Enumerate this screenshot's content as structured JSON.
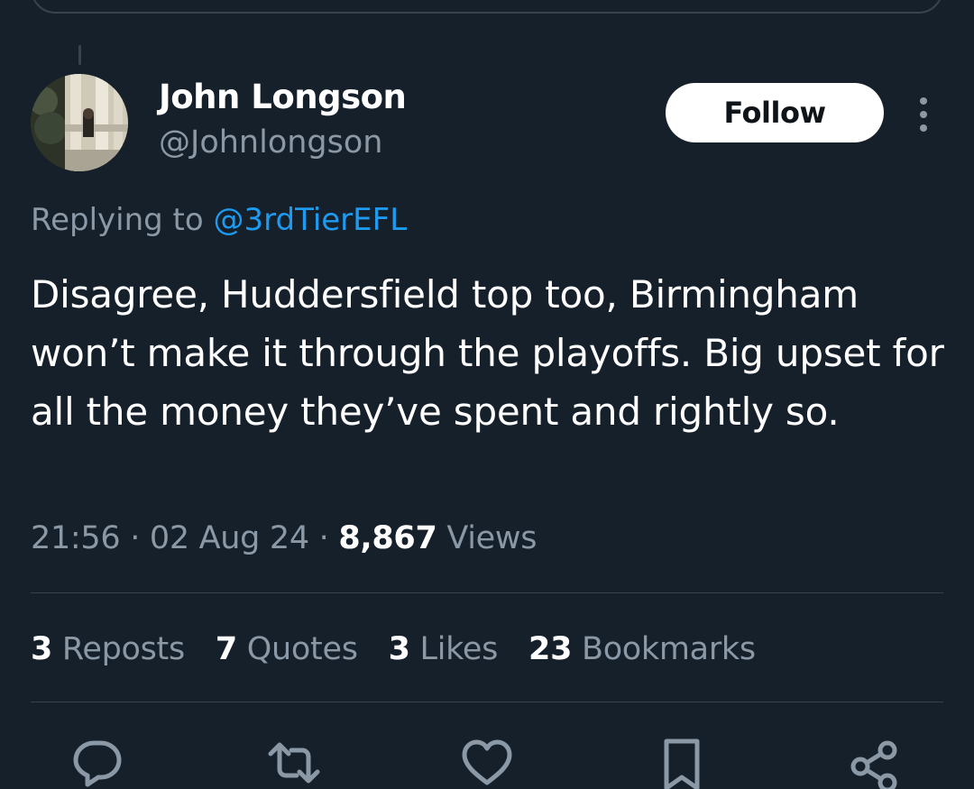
{
  "author": {
    "name": "John Longson",
    "handle": "@Johnlongson"
  },
  "follow_button": {
    "label": "Follow"
  },
  "reply": {
    "prefix": "Replying to ",
    "mention": "@3rdTierEFL"
  },
  "tweet": {
    "text": "Disagree, Huddersfield top too, Birmingham won’t make it through the playoffs. Big upset for all the money they’ve spent and rightly so.",
    "time": "21:56",
    "separator": " · ",
    "date": "02 Aug 24",
    "views_count": "8,867",
    "views_label": " Views"
  },
  "stats": {
    "reposts": {
      "count": "3",
      "label": " Reposts"
    },
    "quotes": {
      "count": "7",
      "label": " Quotes"
    },
    "likes": {
      "count": "3",
      "label": " Likes"
    },
    "bookmarks": {
      "count": "23",
      "label": " Bookmarks"
    }
  },
  "icons": {
    "more": "more-vertical-icon",
    "reply": "reply-icon",
    "repost": "repost-icon",
    "like": "heart-icon",
    "bookmark": "bookmark-icon",
    "share": "share-icon"
  },
  "colors": {
    "background": "#15202b",
    "text": "#ffffff",
    "secondary_text": "#8b98a5",
    "accent": "#1d9bf0",
    "divider": "#38444d"
  }
}
